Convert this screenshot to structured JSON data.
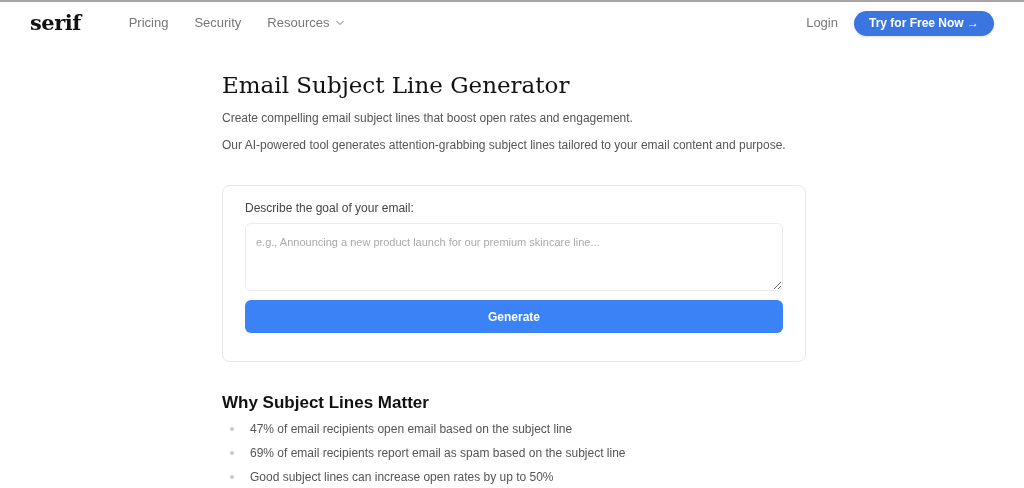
{
  "nav": {
    "logo": "serif",
    "links": [
      {
        "label": "Pricing",
        "dropdown": false
      },
      {
        "label": "Security",
        "dropdown": false
      },
      {
        "label": "Resources",
        "dropdown": true
      }
    ],
    "login": "Login",
    "cta": "Try for Free Now →"
  },
  "hero": {
    "title": "Email Subject Line Generator",
    "paragraphs": [
      "Create compelling email subject lines that boost open rates and engagement.",
      "Our AI-powered tool generates attention-grabbing subject lines tailored to your email content and purpose."
    ]
  },
  "form": {
    "label": "Describe the goal of your email:",
    "placeholder": "e.g., Announcing a new product launch for our premium skincare line...",
    "button": "Generate"
  },
  "why": {
    "heading": "Why Subject Lines Matter",
    "items": [
      "47% of email recipients open email based on the subject line",
      "69% of email recipients report email as spam based on the subject line",
      "Good subject lines can increase open rates by up to 50%"
    ]
  }
}
